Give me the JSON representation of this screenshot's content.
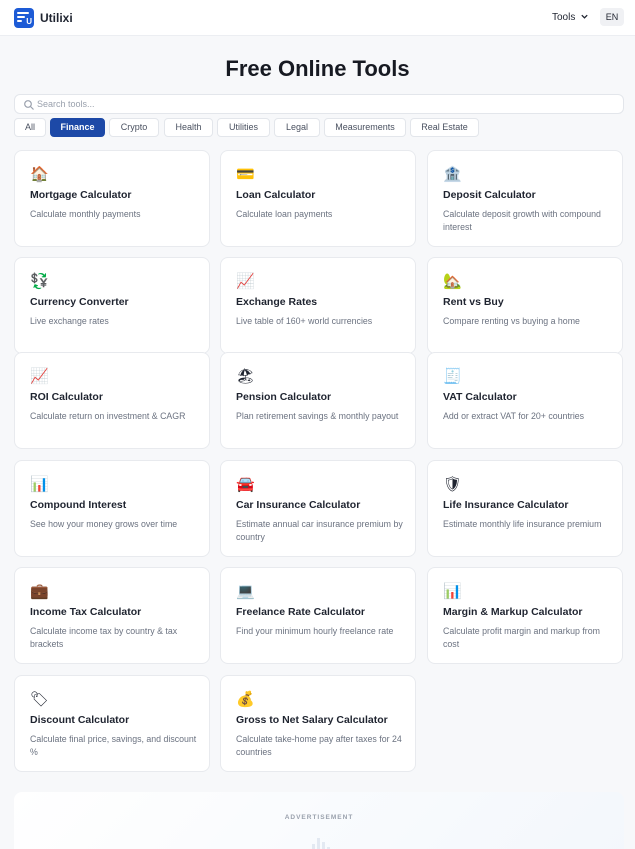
{
  "header": {
    "brand": "Utilixi",
    "tools_label": "Tools",
    "lang_label": "EN"
  },
  "page_title": "Free Online Tools",
  "search": {
    "placeholder": "Search tools...",
    "value": ""
  },
  "tabs": [
    {
      "label": "All",
      "active": false
    },
    {
      "label": "Finance",
      "active": true
    },
    {
      "label": "Crypto",
      "active": false
    },
    {
      "label": "Health",
      "active": false
    },
    {
      "label": "Utilities",
      "active": false
    },
    {
      "label": "Legal",
      "active": false
    },
    {
      "label": "Measurements",
      "active": false
    },
    {
      "label": "Real Estate",
      "active": false
    }
  ],
  "cards": [
    {
      "icon": "house-icon",
      "emoji": "🏠",
      "title": "Mortgage Calculator",
      "desc": "Calculate monthly payments"
    },
    {
      "icon": "credit-card-icon",
      "emoji": "💳",
      "title": "Loan Calculator",
      "desc": "Calculate loan payments"
    },
    {
      "icon": "bank-icon",
      "emoji": "🏦",
      "title": "Deposit Calculator",
      "desc": "Calculate deposit growth with compound interest"
    },
    {
      "icon": "currency-exchange-icon",
      "emoji": "💱",
      "title": "Currency Converter",
      "desc": "Live exchange rates"
    },
    {
      "icon": "chart-up-icon",
      "emoji": "📈",
      "title": "Exchange Rates",
      "desc": "Live table of 160+ world currencies"
    },
    {
      "icon": "house-garden-icon",
      "emoji": "🏡",
      "title": "Rent vs Buy",
      "desc": "Compare renting vs buying a home"
    },
    {
      "icon": "chart-up-icon",
      "emoji": "📈",
      "title": "ROI Calculator",
      "desc": "Calculate return on investment & CAGR"
    },
    {
      "icon": "beach-umbrella-icon",
      "emoji": "🏖",
      "title": "Pension Calculator",
      "desc": "Plan retirement savings & monthly payout"
    },
    {
      "icon": "receipt-icon",
      "emoji": "🧾",
      "title": "VAT Calculator",
      "desc": "Add or extract VAT for 20+ countries"
    },
    {
      "icon": "bar-chart-icon",
      "emoji": "📊",
      "title": "Compound Interest",
      "desc": "See how your money grows over time"
    },
    {
      "icon": "car-icon",
      "emoji": "🚘",
      "title": "Car Insurance Calculator",
      "desc": "Estimate annual car insurance premium by country"
    },
    {
      "icon": "shield-icon",
      "emoji": "🛡",
      "title": "Life Insurance Calculator",
      "desc": "Estimate monthly life insurance premium"
    },
    {
      "icon": "briefcase-icon",
      "emoji": "💼",
      "title": "Income Tax Calculator",
      "desc": "Calculate income tax by country & tax brackets"
    },
    {
      "icon": "laptop-icon",
      "emoji": "💻",
      "title": "Freelance Rate Calculator",
      "desc": "Find your minimum hourly freelance rate"
    },
    {
      "icon": "bar-chart-icon",
      "emoji": "📊",
      "title": "Margin & Markup Calculator",
      "desc": "Calculate profit margin and markup from cost"
    },
    {
      "icon": "price-tag-icon",
      "emoji": "🏷",
      "title": "Discount Calculator",
      "desc": "Calculate final price, savings, and discount %"
    },
    {
      "icon": "money-bag-icon",
      "emoji": "💰",
      "title": "Gross to Net Salary Calculator",
      "desc": "Calculate take-home pay after taxes for 24 countries"
    }
  ],
  "ad": {
    "label": "ADVERTISEMENT"
  },
  "colors": {
    "accent": "#1d49a7",
    "logo": "#1d5bd6",
    "background": "#f7f8fa"
  }
}
